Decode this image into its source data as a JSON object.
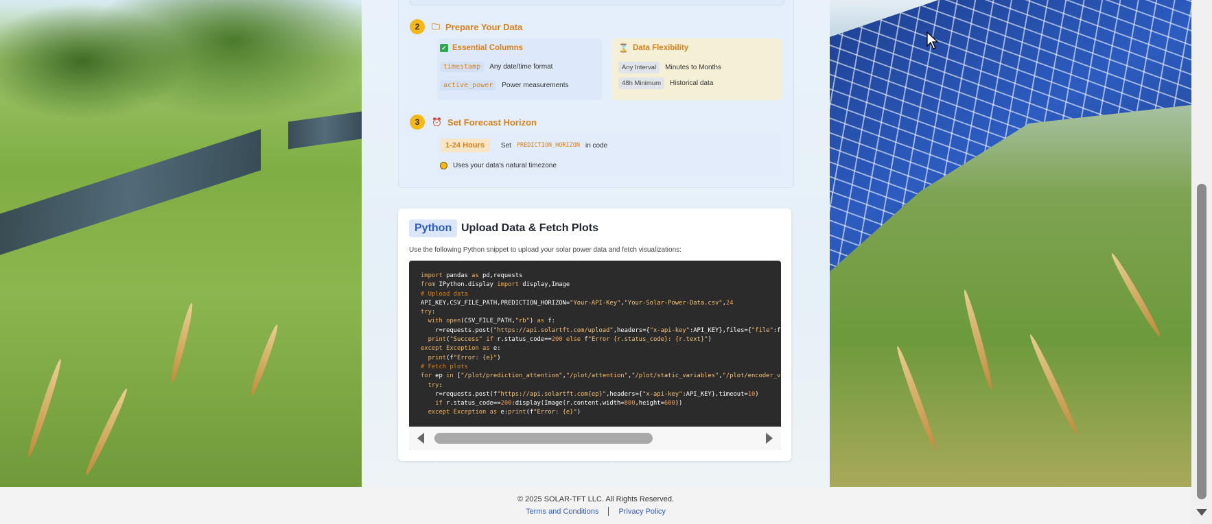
{
  "steps": {
    "step2": {
      "number": "2",
      "title": "Prepare Your Data",
      "icon": "folder-icon",
      "essential": {
        "title": "Essential Columns",
        "icon": "checkbox-icon",
        "rows": [
          {
            "code": "timestamp",
            "desc": "Any date/time format"
          },
          {
            "code": "active_power",
            "desc": "Power measurements"
          }
        ]
      },
      "flexibility": {
        "title": "Data Flexibility",
        "icon": "hourglass-icon",
        "rows": [
          {
            "pill": "Any Interval",
            "desc": "Minutes to Months"
          },
          {
            "pill": "48h Minimum",
            "desc": "Historical data"
          }
        ]
      }
    },
    "step3": {
      "number": "3",
      "title": "Set Forecast Horizon",
      "icon": "alarm-clock-icon",
      "hours": "1-24 Hours",
      "set_prefix": "Set",
      "set_code": "PREDICTION_HORIZON",
      "set_suffix": "in code",
      "timezone_note": "Uses your data's natural timezone"
    }
  },
  "python": {
    "badge": "Python",
    "title": "Upload Data & Fetch Plots",
    "description": "Use the following Python snippet to upload your solar power data and fetch visualizations:",
    "code": [
      "import pandas as pd,requests",
      "from IPython.display import display,Image",
      "# Upload data",
      "API_KEY,CSV_FILE_PATH,PREDICTION_HORIZON=\"Your-API-Key\",\"Your-Solar-Power-Data.csv\",24",
      "try:",
      "  with open(CSV_FILE_PATH,\"rb\") as f:",
      "    r=requests.post(\"https://api.solartft.com/upload\",headers={\"x-api-key\":API_KEY},files={\"file\":f},p",
      "  print(\"Success\" if r.status_code==200 else f\"Error {r.status_code}: {r.text}\")",
      "except Exception as e:",
      "  print(f\"Error: {e}\")",
      "# Fetch plots",
      "for ep in [\"/plot/prediction_attention\",\"/plot/attention\",\"/plot/static_variables\",\"/plot/encoder_vari",
      "  try:",
      "    r=requests.post(f\"https://api.solartft.com{ep}\",headers={\"x-api-key\":API_KEY},timeout=10)",
      "    if r.status_code==200:display(Image(r.content,width=800,height=600))",
      "  except Exception as e:print(f\"Error: {e}\")"
    ]
  },
  "footer": {
    "copyright": "© 2025 SOLAR-TFT LLC. All Rights Reserved.",
    "terms": "Terms and Conditions",
    "privacy": "Privacy Policy"
  },
  "colors": {
    "accent": "#d9811a",
    "step_badge": "#f5b917",
    "python_badge_text": "#2a5cc8",
    "code_bg": "#2b2b2b",
    "link": "#2a5cc8"
  }
}
